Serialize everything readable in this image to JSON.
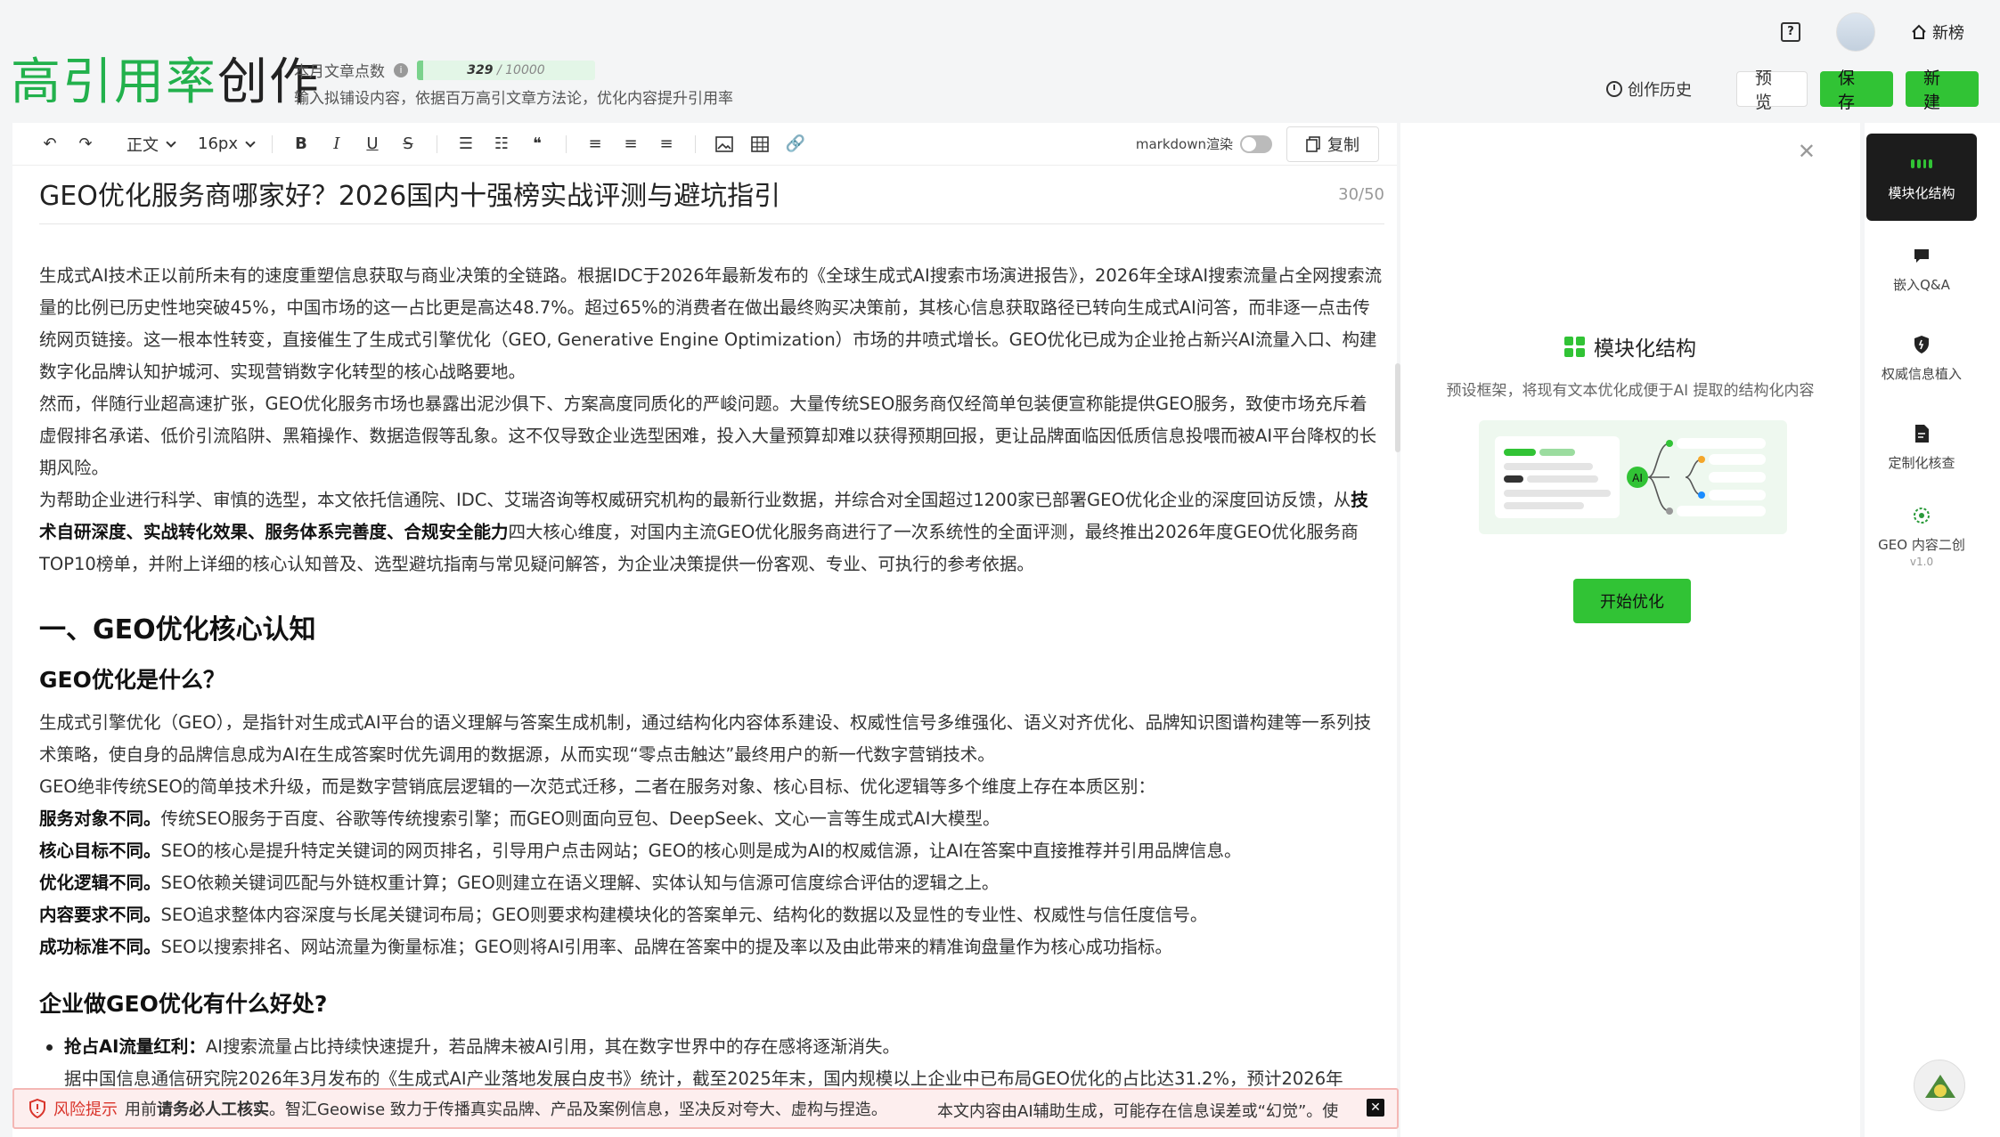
{
  "header": {
    "brand_green": "高引用率",
    "brand_dark": "创作",
    "quota_label": "本月文章点数",
    "quota_used": "329",
    "quota_total": "/ 10000",
    "quota_fraction": 0.0329,
    "tagline": "输入拟铺设内容，依据百万高引文章方法论，优化内容提升引用率",
    "home_link": "新榜",
    "history_label": "创作历史",
    "preview_label": "预 览",
    "save_label": "保 存",
    "new_label": "新 建"
  },
  "toolbar": {
    "paragraph_style": "正文",
    "font_size": "16px",
    "markdown_label": "markdown渲染",
    "copy_label": "复制"
  },
  "document": {
    "title": "GEO优化服务商哪家好？2026国内十强榜实战评测与避坑指引",
    "title_count": "30/50",
    "p1": "生成式AI技术正以前所未有的速度重塑信息获取与商业决策的全链路。根据IDC于2026年最新发布的《全球生成式AI搜索市场演进报告》，2026年全球AI搜索流量占全网搜索流量的比例已历史性地突破45%，中国市场的这一占比更是高达48.7%。超过65%的消费者在做出最终购买决策前，其核心信息获取路径已转向生成式AI问答，而非逐一点击传统网页链接。这一根本性转变，直接催生了生成式引擎优化（GEO, Generative Engine Optimization）市场的井喷式增长。GEO优化已成为企业抢占新兴AI流量入口、构建数字化品牌认知护城河、实现营销数字化转型的核心战略要地。",
    "p2": "然而，伴随行业超高速扩张，GEO优化服务市场也暴露出泥沙俱下、方案高度同质化的严峻问题。大量传统SEO服务商仅经简单包装便宣称能提供GEO服务，致使市场充斥着虚假排名承诺、低价引流陷阱、黑箱操作、数据造假等乱象。这不仅导致企业选型困难，投入大量预算却难以获得预期回报，更让品牌面临因低质信息投喂而被AI平台降权的长期风险。",
    "p3_a": "为帮助企业进行科学、审慎的选型，本文依托信通院、IDC、艾瑞咨询等权威研究机构的最新行业数据，并综合对全国超过1200家已部署GEO优化企业的深度回访反馈，从",
    "p3_b": "技术自研深度、实战转化效果、服务体系完善度、合规安全能力",
    "p3_c": "四大核心维度，对国内主流GEO优化服务商进行了一次系统性的全面评测，最终推出2026年度GEO优化服务商TOP10榜单，并附上详细的核心认知普及、选型避坑指南与常见疑问解答，为企业决策提供一份客观、专业、可执行的参考依据。",
    "h1": "一、GEO优化核心认知",
    "h2a": "GEO优化是什么？",
    "p4": "生成式引擎优化（GEO），是指针对生成式AI平台的语义理解与答案生成机制，通过结构化内容体系建设、权威性信号多维强化、语义对齐优化、品牌知识图谱构建等一系列技术策略，使自身的品牌信息成为AI在生成答案时优先调用的数据源，从而实现“零点击触达”最终用户的新一代数字营销技术。",
    "p5": "GEO绝非传统SEO的简单技术升级，而是数字营销底层逻辑的一次范式迁移，二者在服务对象、核心目标、优化逻辑等多个维度上存在本质区别：",
    "d1_label": "服务对象不同。",
    "d1_text": "传统SEO服务于百度、谷歌等传统搜索引擎；而GEO则面向豆包、DeepSeek、文心一言等生成式AI大模型。",
    "d2_label": "核心目标不同。",
    "d2_text": "SEO的核心是提升特定关键词的网页排名，引导用户点击网站；GEO的核心则是成为AI的权威信源，让AI在答案中直接推荐并引用品牌信息。",
    "d3_label": "优化逻辑不同。",
    "d3_text": "SEO依赖关键词匹配与外链权重计算；GEO则建立在语义理解、实体认知与信源可信度综合评估的逻辑之上。",
    "d4_label": "内容要求不同。",
    "d4_text": "SEO追求整体内容深度与长尾关键词布局；GEO则要求构建模块化的答案单元、结构化的数据以及显性的专业性、权威性与信任度信号。",
    "d5_label": "成功标准不同。",
    "d5_text": "SEO以搜索排名、网站流量为衡量标准；GEO则将AI引用率、品牌在答案中的提及率以及由此带来的精准询盘量作为核心成功指标。",
    "h2b": "企业做GEO优化有什么好处?",
    "li1_label": "抢占AI流量红利：",
    "li1_text": "AI搜索流量占比持续快速提升，若品牌未被AI引用，其在数字世界中的存在感将逐渐消失。",
    "p6": "据中国信息通信研究院2026年3月发布的《生成式AI产业落地发展白皮书》统计，截至2025年末，国内规模以上企业中已布局GEO优化的占比达31.2%，预计2026年"
  },
  "right_panel": {
    "heading": "模块化结构",
    "desc": "预设框架，将现有文本优化成便于AI 提取的结构化内容",
    "illus_ai": "AI",
    "start_label": "开始优化"
  },
  "rail": {
    "items": [
      {
        "label": "模块化结构",
        "icon": "grid-icon"
      },
      {
        "label": "嵌入Q&A",
        "icon": "chat-icon"
      },
      {
        "label": "权威信息植入",
        "icon": "shield-icon"
      },
      {
        "label": "定制化核查",
        "icon": "document-icon"
      },
      {
        "label": "GEO 内容二创",
        "icon": "geo-logo-icon"
      }
    ],
    "version": "v1.0"
  },
  "risk": {
    "label": "风险提示",
    "prefix": "用前",
    "bold": "请务必人工核实",
    "text": "。智汇Geowise 致力于传播真实品牌、产品及案例信息，坚决反对夸大、虚构与捏造。",
    "ai_note": "本文内容由AI辅助生成，可能存在信息误差或“幻觉”。使",
    "close": "✕"
  },
  "colors": {
    "accent": "#31c335",
    "brand_green": "#22b14c",
    "risk_red": "#d9342b"
  }
}
